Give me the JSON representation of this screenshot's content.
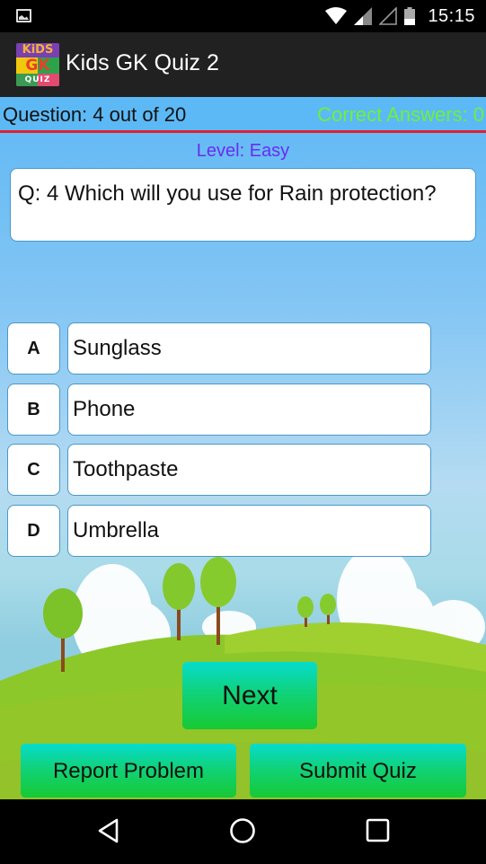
{
  "status_bar": {
    "time": "15:15",
    "icons": [
      "gallery-notification-icon",
      "wifi-icon",
      "cell-signal-icon",
      "cell-signal-empty-icon",
      "battery-icon"
    ]
  },
  "app_bar": {
    "title": "Kids GK Quiz 2",
    "logo": {
      "line1": "KiDS",
      "line2": "GK",
      "line3": "QUIZ"
    }
  },
  "quiz": {
    "progress": "Question: 4 out of 20",
    "correct_answers": "Correct Answers: 0",
    "level": "Level: Easy",
    "question": "Q: 4  Which will you use for Rain protection?",
    "options": [
      {
        "letter": "A",
        "text": "Sunglass"
      },
      {
        "letter": "B",
        "text": "Phone"
      },
      {
        "letter": "C",
        "text": "Toothpaste"
      },
      {
        "letter": "D",
        "text": "Umbrella"
      }
    ]
  },
  "buttons": {
    "next": "Next",
    "report": "Report Problem",
    "submit": "Submit Quiz"
  },
  "colors": {
    "header_bg": "#5cb9f5",
    "divider": "#e02030",
    "correct_text": "#6df23b",
    "level_text": "#6a2cf0",
    "button_green": "#17c933",
    "button_cyan": "#06dccf"
  },
  "nav_bar": {
    "icons": [
      "back-icon",
      "home-icon",
      "recents-icon"
    ]
  }
}
